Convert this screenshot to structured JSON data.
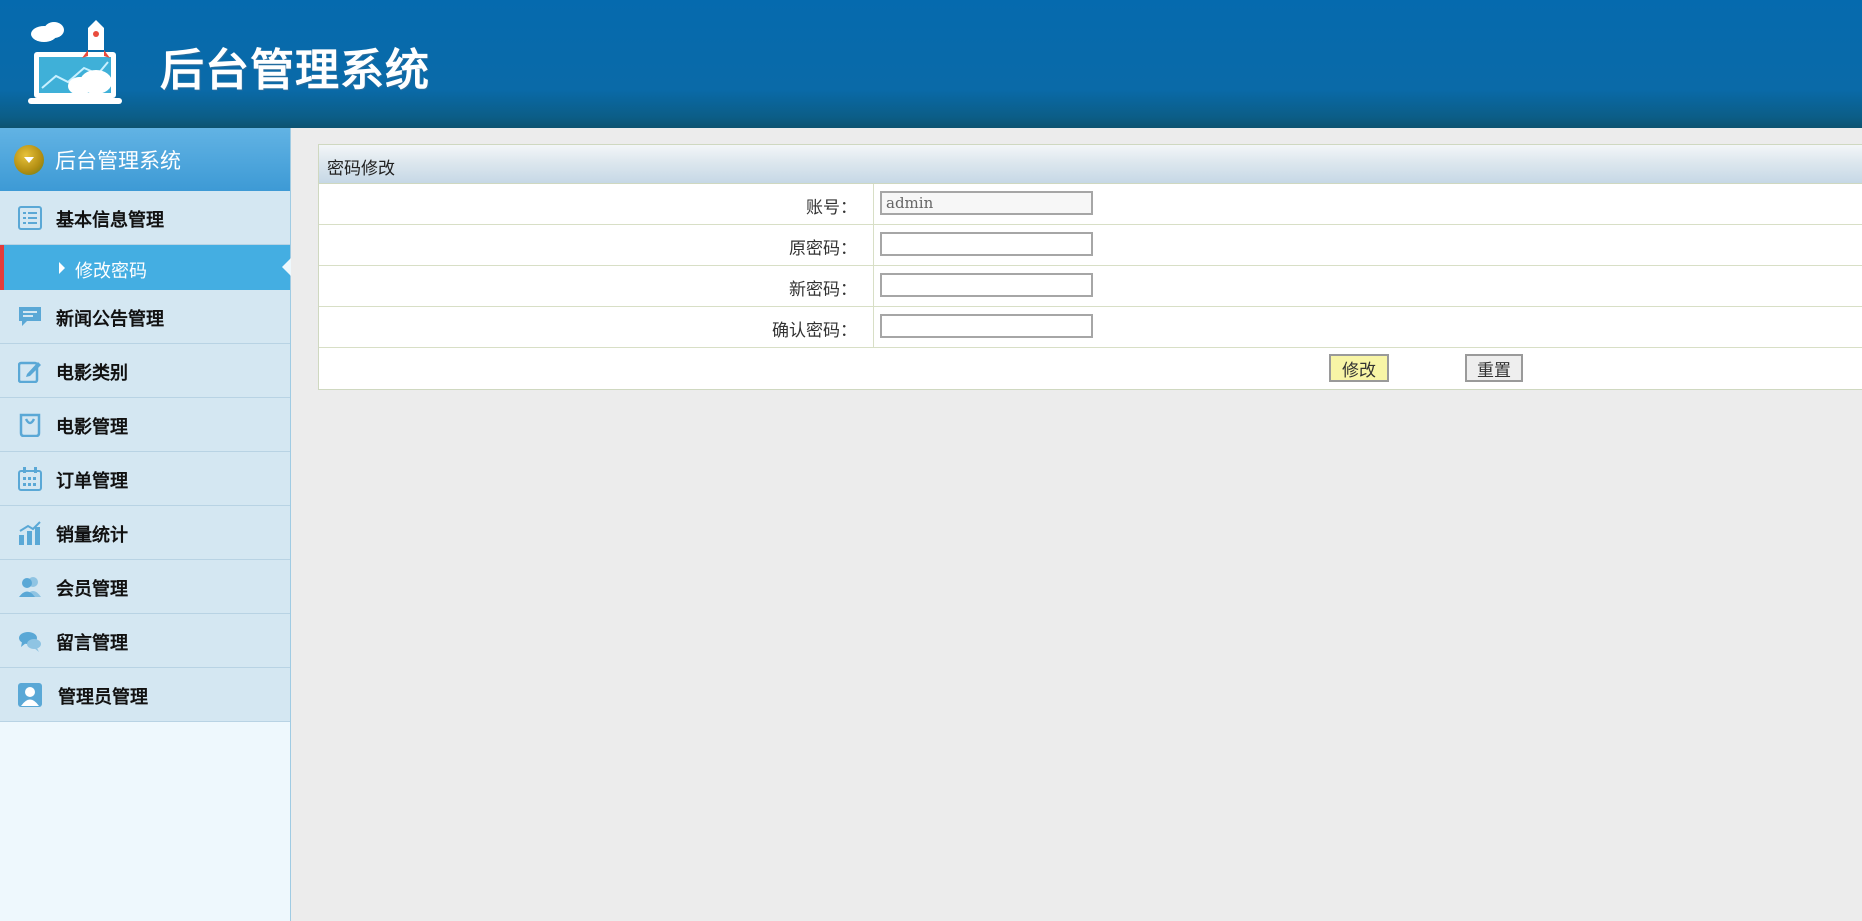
{
  "header": {
    "title": "后台管理系统"
  },
  "sidebar": {
    "head_label": "后台管理系统",
    "items": [
      {
        "label": "基本信息管理",
        "icon": "list-icon"
      },
      {
        "label": "修改密码",
        "icon": "arrow-right-icon",
        "sub": true,
        "active": true
      },
      {
        "label": "新闻公告管理",
        "icon": "comment-icon"
      },
      {
        "label": "电影类别",
        "icon": "edit-icon"
      },
      {
        "label": "电影管理",
        "icon": "bag-icon"
      },
      {
        "label": "订单管理",
        "icon": "calendar-icon"
      },
      {
        "label": "销量统计",
        "icon": "chart-icon"
      },
      {
        "label": "会员管理",
        "icon": "users-icon"
      },
      {
        "label": "留言管理",
        "icon": "chat-icon"
      },
      {
        "label": "管理员管理",
        "icon": "user-icon"
      }
    ]
  },
  "panel": {
    "title": "密码修改",
    "fields": [
      {
        "label": "账号：",
        "value": "admin"
      },
      {
        "label": "原密码：",
        "value": ""
      },
      {
        "label": "新密码：",
        "value": ""
      },
      {
        "label": "确认密码：",
        "value": ""
      }
    ],
    "save_label": "修改",
    "reset_label": "重置"
  },
  "colors": {
    "header": "#056aae",
    "sidebar_active": "#44aee2",
    "active_marker": "#e53b3b",
    "save_button": "#f8f5a6"
  }
}
